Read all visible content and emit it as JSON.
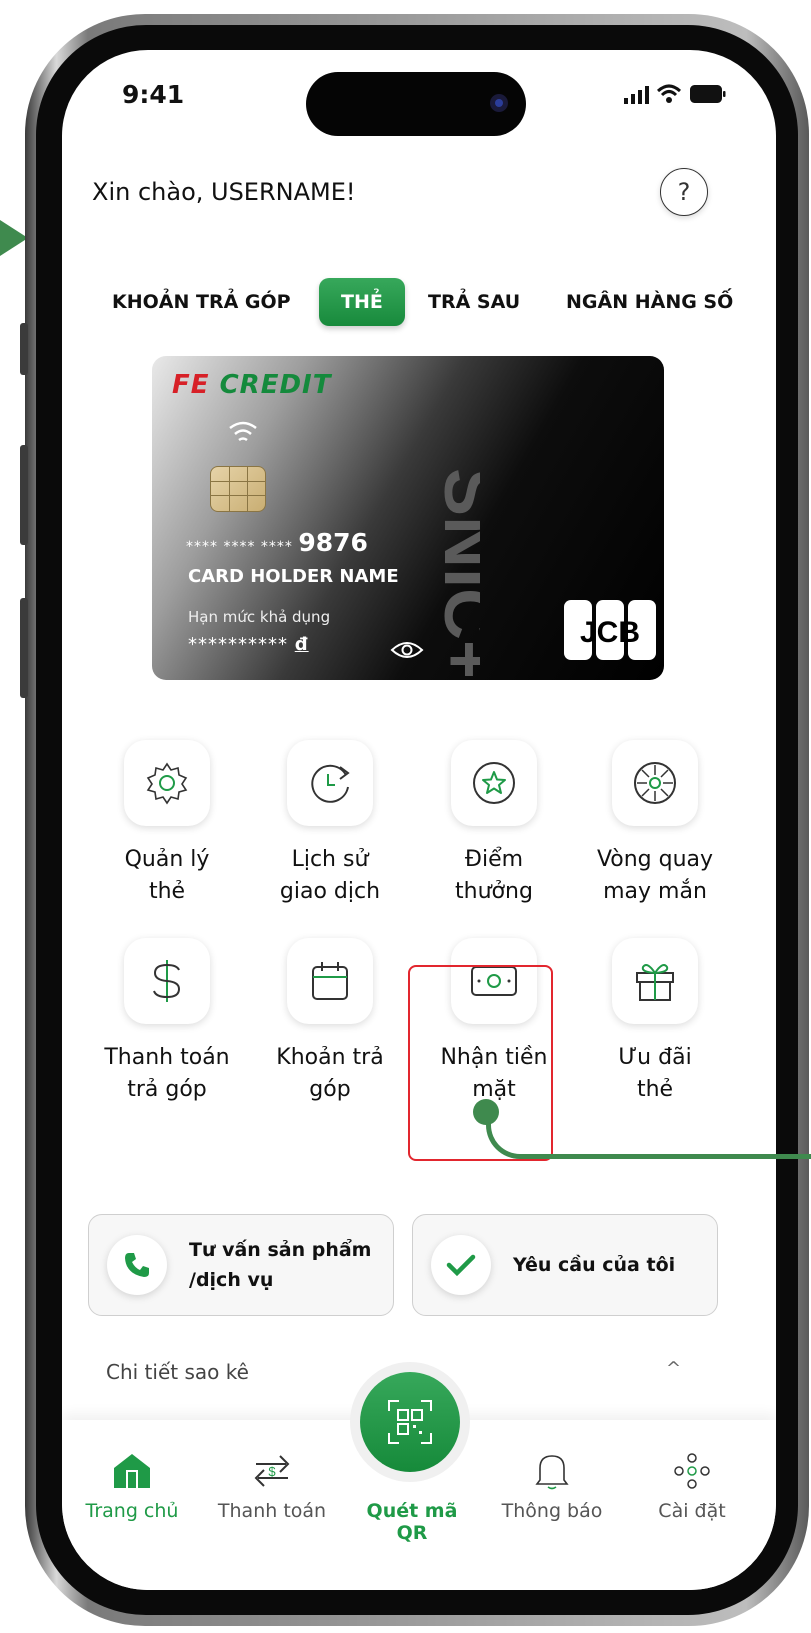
{
  "status": {
    "time": "9:41"
  },
  "header": {
    "greeting": "Xin chào,  USERNAME!",
    "help_glyph": "?"
  },
  "tabs": [
    {
      "label": "KHOẢN TRẢ GÓP",
      "active": false
    },
    {
      "label": "THẺ",
      "active": true
    },
    {
      "label": "TRẢ SAU",
      "active": false
    },
    {
      "label": "NGÂN HÀNG SỐ",
      "active": false
    }
  ],
  "card": {
    "brand_fe": "FE",
    "brand_credit": "CREDIT",
    "masked_digits": "**** **** ****",
    "last4": "9876",
    "holder": "CARD HOLDER NAME",
    "limit_label": "Hạn mức khả dụng",
    "limit_value": "**********",
    "currency": "đ",
    "network": "JCB",
    "watermark": "SNIC+"
  },
  "menu": [
    {
      "label": "Quản lý thẻ",
      "line1": "Quản lý",
      "line2": "thẻ",
      "icon": "gear-icon"
    },
    {
      "label": "Lịch sử giao dịch",
      "line1": "Lịch sử",
      "line2": "giao dịch",
      "icon": "history-icon"
    },
    {
      "label": "Điểm thưởng",
      "line1": "Điểm",
      "line2": "thưởng",
      "icon": "star-icon"
    },
    {
      "label": "Vòng quay may mắn",
      "line1": "Vòng quay",
      "line2": "may mắn",
      "icon": "lucky-wheel-icon"
    },
    {
      "label": "Thanh toán trả góp",
      "line1": "Thanh toán",
      "line2": "trả góp",
      "icon": "dollar-icon"
    },
    {
      "label": "Khoản trả góp",
      "line1": "Khoản trả",
      "line2": "góp",
      "icon": "calendar-icon"
    },
    {
      "label": "Nhận tiền mặt",
      "line1": "Nhận tiền",
      "line2": "mặt",
      "icon": "cash-icon"
    },
    {
      "label": "Ưu đãi thẻ",
      "line1": "Ưu đãi",
      "line2": "thẻ",
      "icon": "gift-icon"
    }
  ],
  "actions": {
    "consult_line1": "Tư vấn sản phẩm",
    "consult_line2": "/dịch vụ",
    "requests": "Yêu cầu của tôi"
  },
  "statement": {
    "label": "Chi tiết sao kê",
    "caret": "^"
  },
  "nav": {
    "home": "Trang chủ",
    "payment": "Thanh toán",
    "scan_line1": "Quét mã",
    "scan_line2": "QR",
    "notifications": "Thông báo",
    "settings": "Cài đặt"
  },
  "colors": {
    "accent": "#1f9a47",
    "highlight": "#e2262e",
    "annotation": "#3f8a4e",
    "fe_red": "#d72027"
  }
}
